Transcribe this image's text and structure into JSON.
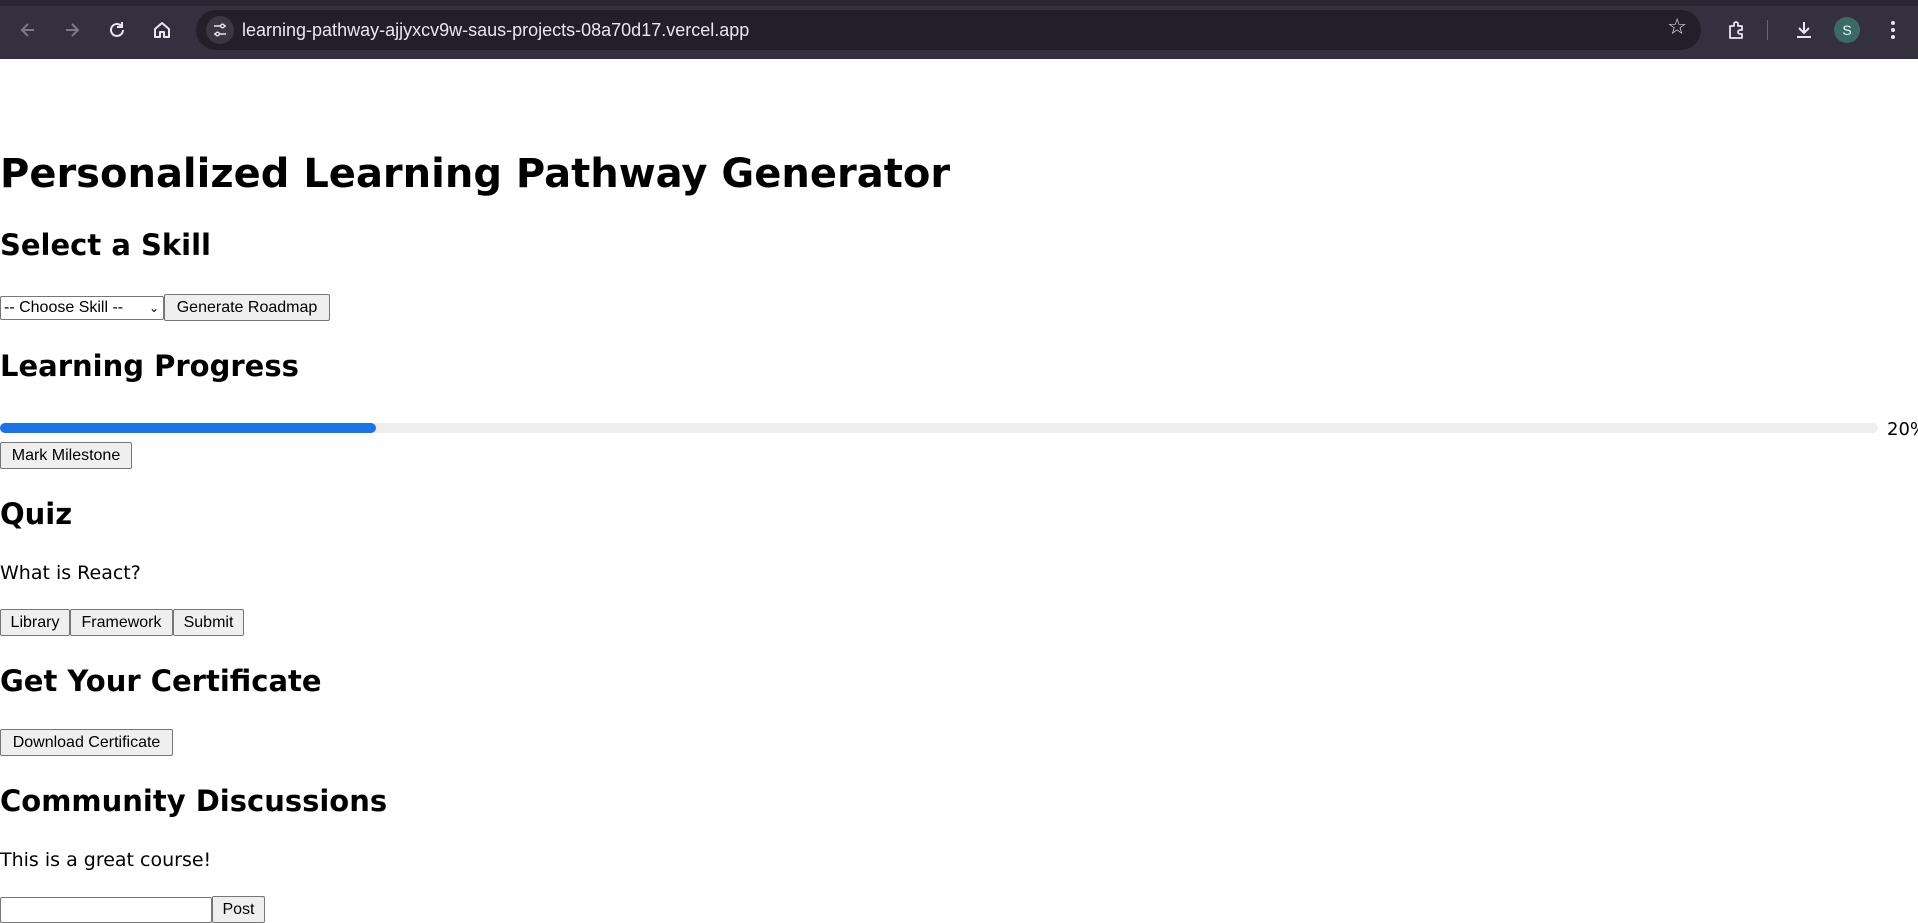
{
  "browser": {
    "url": "learning-pathway-ajjyxcv9w-saus-projects-08a70d17.vercel.app",
    "profile_initial": "S",
    "icons": [
      "back-icon",
      "forward-icon",
      "reload-icon",
      "home-icon",
      "site-info-icon",
      "bookmark-star-icon",
      "extensions-icon",
      "download-icon",
      "menu-icon"
    ]
  },
  "page": {
    "title": "Personalized Learning Pathway Generator",
    "skill": {
      "heading": "Select a Skill",
      "select_value": "-- Choose Skill --",
      "generate_label": "Generate Roadmap"
    },
    "progress": {
      "heading": "Learning Progress",
      "percent": 20,
      "percent_label": "20%",
      "milestone_label": "Mark Milestone",
      "fill_color": "#1a73e8"
    },
    "quiz": {
      "heading": "Quiz",
      "question": "What is React?",
      "options": [
        "Library",
        "Framework"
      ],
      "submit_label": "Submit"
    },
    "certificate": {
      "heading": "Get Your Certificate",
      "download_label": "Download Certificate"
    },
    "community": {
      "heading": "Community Discussions",
      "comments": [
        "This is a great course!"
      ],
      "input_value": "",
      "post_label": "Post"
    }
  }
}
